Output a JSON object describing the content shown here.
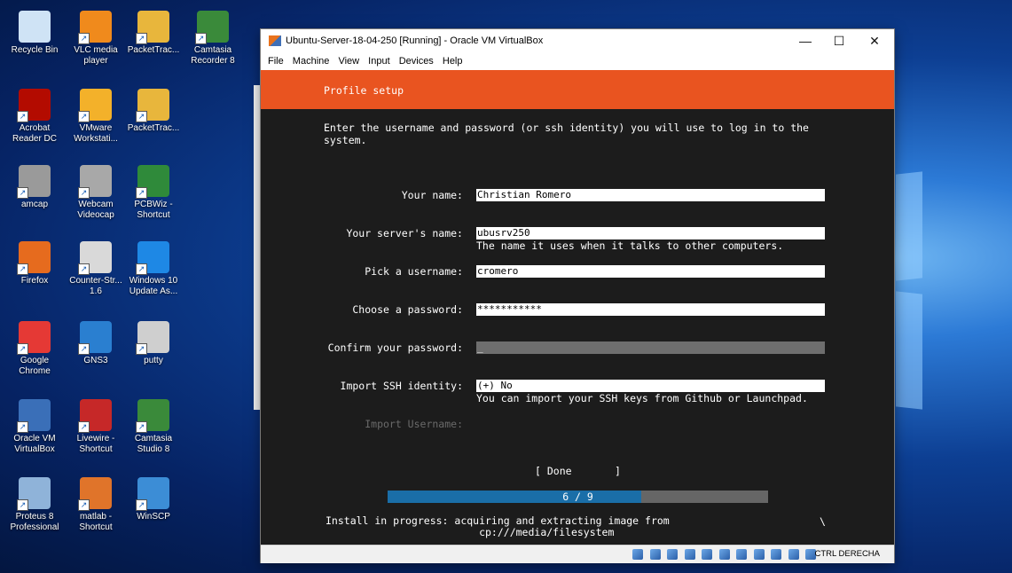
{
  "desktop": {
    "icons": [
      {
        "label": "Recycle Bin",
        "icon": "recycle-bin-icon",
        "color": "#cfe3f5"
      },
      {
        "label": "VLC media player",
        "icon": "vlc-icon",
        "color": "#f08a1c"
      },
      {
        "label": "PacketTrac...",
        "icon": "packet-tracer-icon",
        "color": "#e8b63c"
      },
      {
        "label": "Camtasia Recorder 8",
        "icon": "camtasia-recorder-icon",
        "color": "#3a8a3a"
      },
      {
        "label": "Acrobat Reader DC",
        "icon": "acrobat-icon",
        "color": "#b30b00"
      },
      {
        "label": "VMware Workstati...",
        "icon": "vmware-icon",
        "color": "#f3b12a"
      },
      {
        "label": "PacketTrac...",
        "icon": "packet-tracer-icon",
        "color": "#e8b63c"
      },
      {
        "label": "amcap",
        "icon": "amcap-icon",
        "color": "#9a9a9a"
      },
      {
        "label": "Webcam Videocap",
        "icon": "webcam-icon",
        "color": "#a8a8a8"
      },
      {
        "label": "PCBWiz - Shortcut",
        "icon": "pcb-icon",
        "color": "#2f8a3a"
      },
      {
        "label": "Firefox",
        "icon": "firefox-icon",
        "color": "#e66b1e"
      },
      {
        "label": "Counter-Str... 1.6",
        "icon": "counter-strike-icon",
        "color": "#d9d9d9"
      },
      {
        "label": "Windows 10 Update As...",
        "icon": "windows-icon",
        "color": "#1e88e5"
      },
      {
        "label": "Google Chrome",
        "icon": "chrome-icon",
        "color": "#e53935"
      },
      {
        "label": "GNS3",
        "icon": "gns3-icon",
        "color": "#2a7fd0"
      },
      {
        "label": "putty",
        "icon": "putty-icon",
        "color": "#cfcfcf"
      },
      {
        "label": "Oracle VM VirtualBox",
        "icon": "virtualbox-icon",
        "color": "#3a6fb8"
      },
      {
        "label": "Livewire - Shortcut",
        "icon": "livewire-icon",
        "color": "#c62828"
      },
      {
        "label": "Camtasia Studio 8",
        "icon": "camtasia-studio-icon",
        "color": "#3a8a3a"
      },
      {
        "label": "Proteus 8 Professional",
        "icon": "proteus-icon",
        "color": "#8fb3d9"
      },
      {
        "label": "matlab - Shortcut",
        "icon": "matlab-icon",
        "color": "#e0742a"
      },
      {
        "label": "WinSCP",
        "icon": "winscp-icon",
        "color": "#3c8dd6"
      }
    ]
  },
  "window": {
    "title": "Ubuntu-Server-18-04-250 [Running] - Oracle VM VirtualBox",
    "minimize": "—",
    "maximize": "☐",
    "close": "✕",
    "menu": [
      "File",
      "Machine",
      "View",
      "Input",
      "Devices",
      "Help"
    ]
  },
  "installer": {
    "header": "Profile setup",
    "intro": "Enter the username and password (or ssh identity) you will use to log in to the\nsystem.",
    "fields": {
      "your_name": {
        "label": "Your name:",
        "value": "Christian Romero"
      },
      "server_name": {
        "label": "Your server's name:",
        "value": "ubusrv250",
        "hint": "The name it uses when it talks to other computers."
      },
      "username": {
        "label": "Pick a username:",
        "value": "cromero"
      },
      "password": {
        "label": "Choose a password:",
        "value": "***********"
      },
      "confirm": {
        "label": "Confirm your password:",
        "value": "_"
      },
      "ssh": {
        "label": "Import SSH identity:",
        "value": "(+) No",
        "hint": "You can import your SSH keys from Github or Launchpad."
      },
      "import_username": {
        "label": "Import Username:"
      }
    },
    "done_button": "[ Done       ]",
    "progress": {
      "text": "6 / 9",
      "fraction": 0.667
    },
    "status": "Install in progress: acquiring and extracting image from\n                         cp:///media/filesystem",
    "spinner": "\\"
  },
  "statusbar": {
    "host_key": "CTRL DERECHA"
  }
}
